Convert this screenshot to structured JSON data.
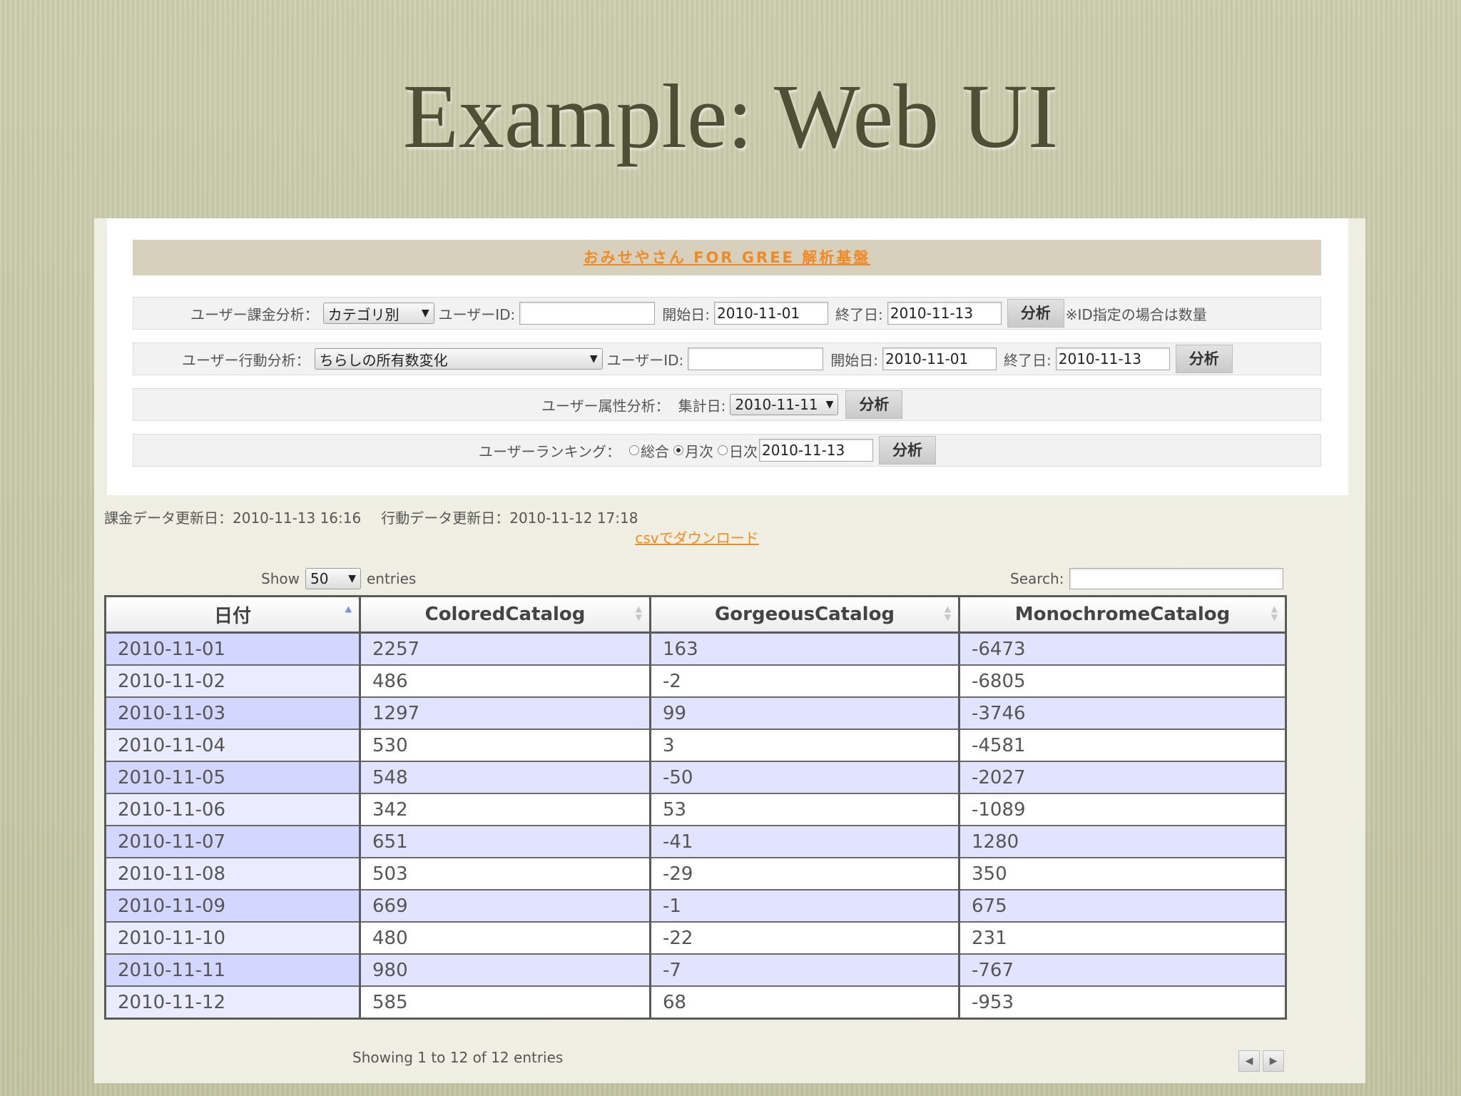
{
  "slide": {
    "title": "Example: Web UI"
  },
  "banner": {
    "link": "おみせやさん FOR GREE 解析基盤"
  },
  "billing": {
    "label": "ユーザー課金分析：",
    "category_value": "カテゴリ別",
    "userid_label": "ユーザーID:",
    "userid_value": "",
    "start_label": "開始日:",
    "start_value": "2010-11-01",
    "end_label": "終了日:",
    "end_value": "2010-11-13",
    "button": "分析",
    "note": "※ID指定の場合は数量"
  },
  "behavior": {
    "label": "ユーザー行動分析：",
    "type_value": "ちらしの所有数変化",
    "userid_label": "ユーザーID:",
    "userid_value": "",
    "start_label": "開始日:",
    "start_value": "2010-11-01",
    "end_label": "終了日:",
    "end_value": "2010-11-13",
    "button": "分析"
  },
  "attribute": {
    "label": "ユーザー属性分析：",
    "date_label": "集計日:",
    "date_value": "2010-11-11",
    "button": "分析"
  },
  "ranking": {
    "label": "ユーザーランキング：",
    "opt_total": "総合",
    "opt_monthly": "月次",
    "opt_daily": "日次",
    "selected": "月次",
    "date_value": "2010-11-13",
    "button": "分析"
  },
  "meta": {
    "billing_updated": "課金データ更新日：2010-11-13 16:16",
    "behavior_updated": "行動データ更新日：2010-11-12 17:18",
    "csv_link": "csvでダウンロード"
  },
  "table_controls": {
    "show_label": "Show",
    "entries_value": "50",
    "entries_label": "entries",
    "search_label": "Search:",
    "search_value": "",
    "info": "Showing 1 to 12 of 12 entries"
  },
  "table": {
    "headers": [
      "日付",
      "ColoredCatalog",
      "GorgeousCatalog",
      "MonochromeCatalog"
    ],
    "rows": [
      [
        "2010-11-01",
        "2257",
        "163",
        "-6473"
      ],
      [
        "2010-11-02",
        "486",
        "-2",
        "-6805"
      ],
      [
        "2010-11-03",
        "1297",
        "99",
        "-3746"
      ],
      [
        "2010-11-04",
        "530",
        "3",
        "-4581"
      ],
      [
        "2010-11-05",
        "548",
        "-50",
        "-2027"
      ],
      [
        "2010-11-06",
        "342",
        "53",
        "-1089"
      ],
      [
        "2010-11-07",
        "651",
        "-41",
        "1280"
      ],
      [
        "2010-11-08",
        "503",
        "-29",
        "350"
      ],
      [
        "2010-11-09",
        "669",
        "-1",
        "675"
      ],
      [
        "2010-11-10",
        "480",
        "-22",
        "231"
      ],
      [
        "2010-11-11",
        "980",
        "-7",
        "-767"
      ],
      [
        "2010-11-12",
        "585",
        "68",
        "-953"
      ]
    ]
  },
  "colors": {
    "link": "#f08a24",
    "row_odd": "#e2e4ff",
    "sort_active": "#7b8ee0"
  }
}
